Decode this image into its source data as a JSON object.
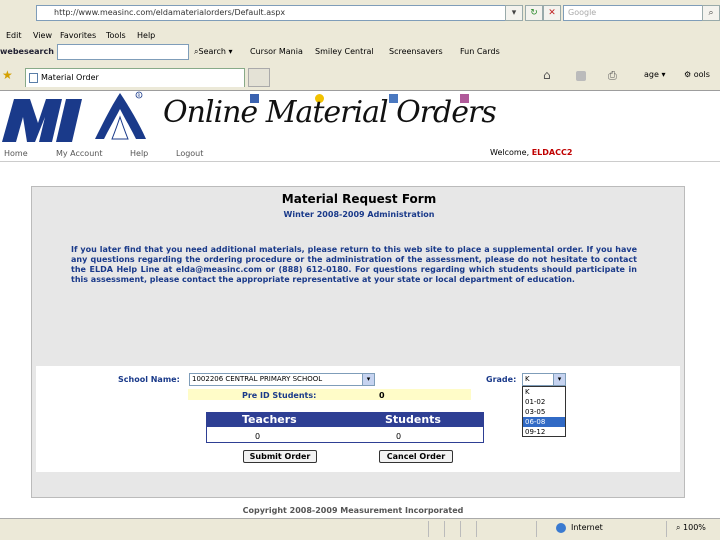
{
  "browser": {
    "address": "http://www.measinc.com/eldamaterialorders/Default.aspx",
    "search_placeholder": "Google",
    "menu": [
      "Edit",
      "View",
      "Favorites",
      "Tools",
      "Help"
    ],
    "toolbar_brand": "webesearch",
    "toolbar_search_label": "Search",
    "toolbar_items": [
      "Cursor Mania",
      "Smiley Central",
      "Screensavers",
      "Fun Cards"
    ],
    "tab_title": "Material Order",
    "tools_page": "age",
    "tools_tools": "ools"
  },
  "site": {
    "title": "Online Material Orders",
    "logo_text": "MI",
    "nav": [
      "Home",
      "My Account",
      "Help",
      "Logout"
    ],
    "welcome": "Welcome,",
    "username": "ELDACC2"
  },
  "form": {
    "title": "Material Request Form",
    "subtitle": "Winter 2008-2009 Administration",
    "intro": "If you later find that you need additional materials, please return to this web site to place a supplemental order. If you have any questions regarding the ordering procedure or the administration of the assessment, please do not hesitate to contact the ELDA Help Line at elda@measinc.com or (888) 612-0180. For questions regarding which students should participate in this assessment, please contact the appropriate representative at your state or local department of education.",
    "school_label": "School Name:",
    "school_value": "1002206 CENTRAL PRIMARY SCHOOL",
    "grade_label": "Grade:",
    "grade_value": "K",
    "grade_options": [
      "K",
      "01-02",
      "03-05",
      "06-08",
      "09-12"
    ],
    "grade_highlighted": "06-08",
    "pre_id_label": "Pre ID Students:",
    "pre_id_value": "0",
    "teachers_header": "Teachers",
    "students_header": "Students",
    "teachers_value": "0",
    "students_value": "0",
    "submit_label": "Submit Order",
    "cancel_label": "Cancel Order",
    "copyright": "Copyright 2008-2009 Measurement Incorporated"
  },
  "status": {
    "zone": "Internet",
    "zoom": "100%"
  }
}
